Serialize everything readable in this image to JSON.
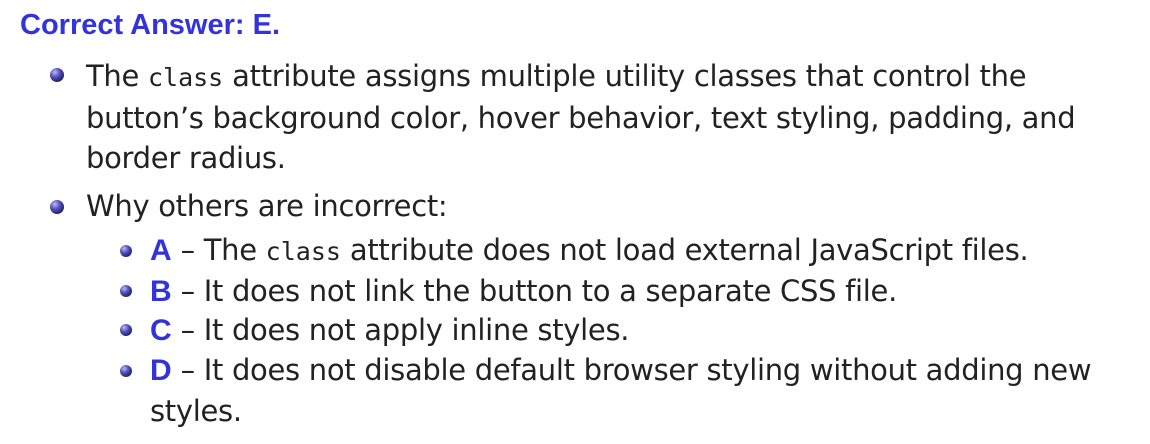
{
  "heading": "Correct Answer: E.",
  "bullet1": {
    "pre": "The ",
    "code": "class",
    "post": " attribute assigns multiple utility classes that control the button’s background color, hover behavior, text styling, padding, and border radius."
  },
  "bullet2": {
    "text": "Why others are incorrect:",
    "items": [
      {
        "letter": "A",
        "dash": " – The ",
        "code": "class",
        "rest": " attribute does not load external JavaScript files."
      },
      {
        "letter": "B",
        "rest": " – It does not link the button to a separate CSS file."
      },
      {
        "letter": "C",
        "rest": " – It does not apply inline styles."
      },
      {
        "letter": "D",
        "rest": " – It does not disable default browser styling without adding new styles."
      }
    ]
  }
}
